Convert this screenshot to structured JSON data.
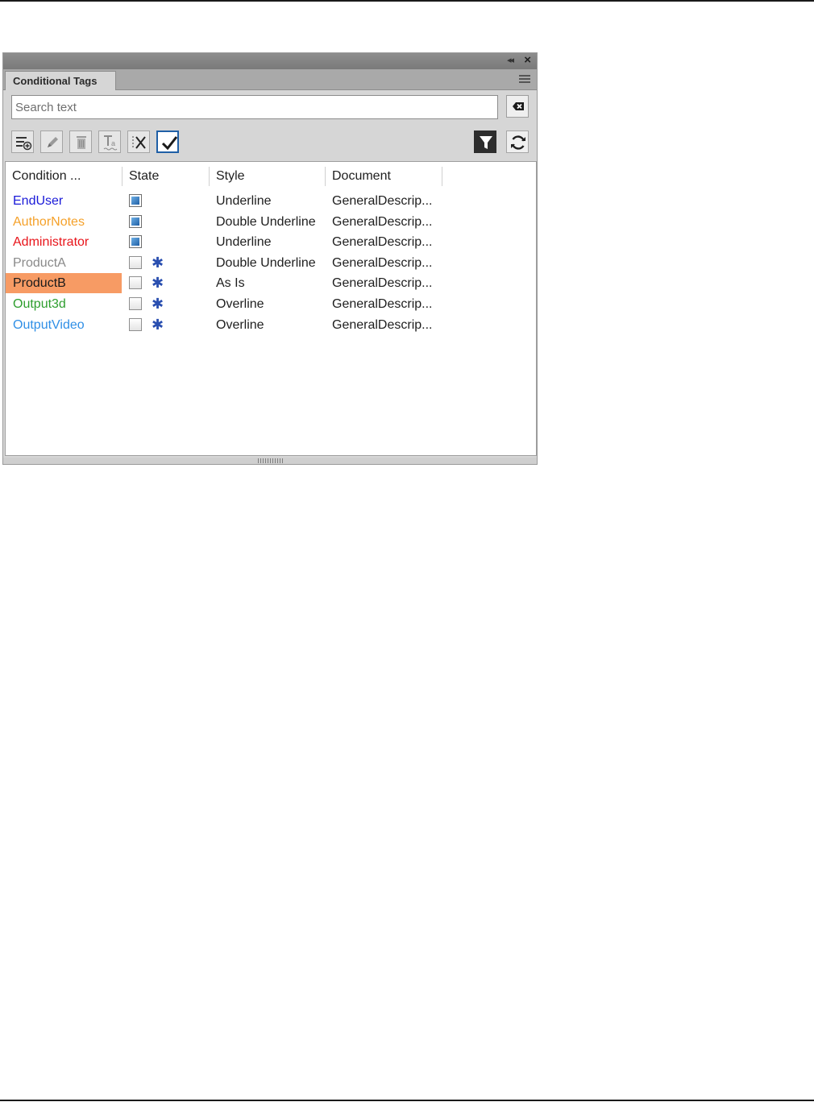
{
  "panel": {
    "tab_title": "Conditional Tags",
    "search": {
      "placeholder": "Search text",
      "value": ""
    }
  },
  "toolbar": {
    "left_icons": [
      "new-condition-icon",
      "edit-icon",
      "delete-icon",
      "text-style-icon",
      "remove-condition-icon",
      "checkbox-icon"
    ],
    "right_icons": [
      "filter-icon",
      "refresh-icon"
    ]
  },
  "table": {
    "headers": [
      "Condition ...",
      "State",
      "Style",
      "Document"
    ],
    "rows": [
      {
        "condition": "EndUser",
        "color": "#1a1ad8",
        "state": "on",
        "modified": false,
        "style": "Underline",
        "document": "GeneralDescrip...",
        "selected": false
      },
      {
        "condition": "AuthorNotes",
        "color": "#f5a12a",
        "state": "on",
        "modified": false,
        "style": "Double Underline",
        "document": "GeneralDescrip...",
        "selected": false
      },
      {
        "condition": "Administrator",
        "color": "#e8141a",
        "state": "on",
        "modified": false,
        "style": "Underline",
        "document": "GeneralDescrip...",
        "selected": false
      },
      {
        "condition": "ProductA",
        "color": "#8a8a8a",
        "state": "off",
        "modified": true,
        "style": "Double Underline",
        "document": "GeneralDescrip...",
        "selected": false
      },
      {
        "condition": "ProductB",
        "color": "#1a1a1a",
        "state": "off",
        "modified": true,
        "style": "As Is",
        "document": "GeneralDescrip...",
        "selected": true
      },
      {
        "condition": "Output3d",
        "color": "#2e9e2e",
        "state": "off",
        "modified": true,
        "style": "Overline",
        "document": "GeneralDescrip...",
        "selected": false
      },
      {
        "condition": "OutputVideo",
        "color": "#2f8fe6",
        "state": "off",
        "modified": true,
        "style": "Overline",
        "document": "GeneralDescrip...",
        "selected": false
      }
    ],
    "modified_marker": "✱"
  }
}
